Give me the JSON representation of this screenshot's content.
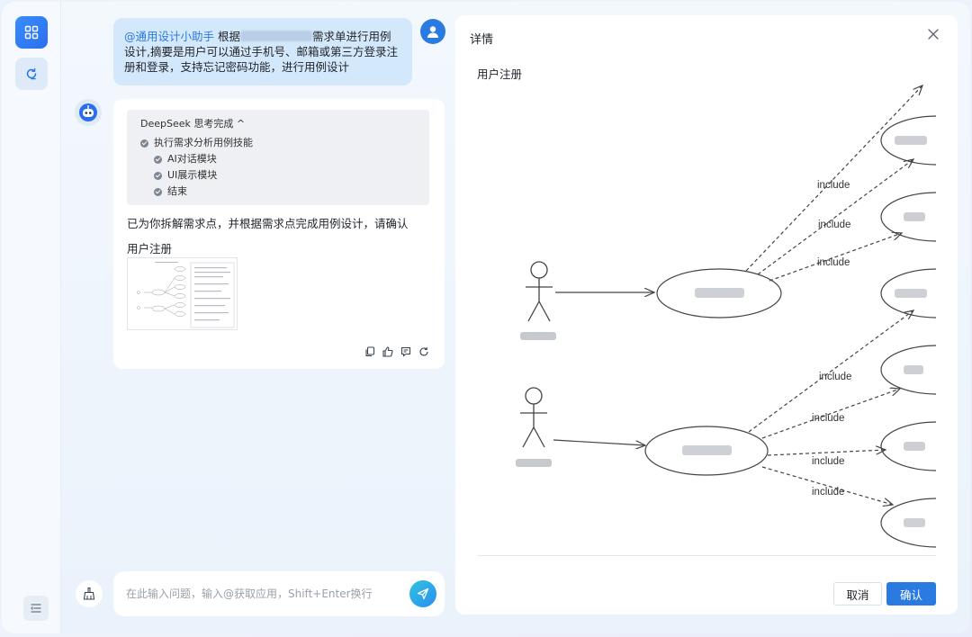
{
  "sidebar": {
    "apps_icon": "grid-icon",
    "new_chat_icon": "refresh-chat-icon",
    "collapse_icon": "collapse-menu-icon"
  },
  "chat": {
    "user_message": {
      "mention": "@通用设计小助手",
      "part1": " 根据",
      "part2": "需求单进行用例设计,摘要是用户可以通过手机号、邮箱或第三方登录注册和登录，支持忘记密码功能，进行用例设计"
    },
    "bot": {
      "thinking_title": "DeepSeek 思考完成 ^",
      "thinking_steps": [
        {
          "label": "执行需求分析用例技能"
        },
        {
          "label": "AI对话模块"
        },
        {
          "label": "UI展示模块"
        },
        {
          "label": "结束"
        }
      ],
      "reply": "已为你拆解需求点，并根据需求点完成用例设计，请确认",
      "attachment_label": "用户注册"
    },
    "input": {
      "placeholder": "在此输入问题，输入@获取应用，Shift+Enter换行"
    }
  },
  "detail": {
    "title": "详情",
    "diagram_title": "用户注册",
    "include_label": "include",
    "cancel_label": "取消",
    "confirm_label": "确认"
  },
  "colors": {
    "accent": "#2a7ae2",
    "user_bubble": "#d4e8fb"
  }
}
